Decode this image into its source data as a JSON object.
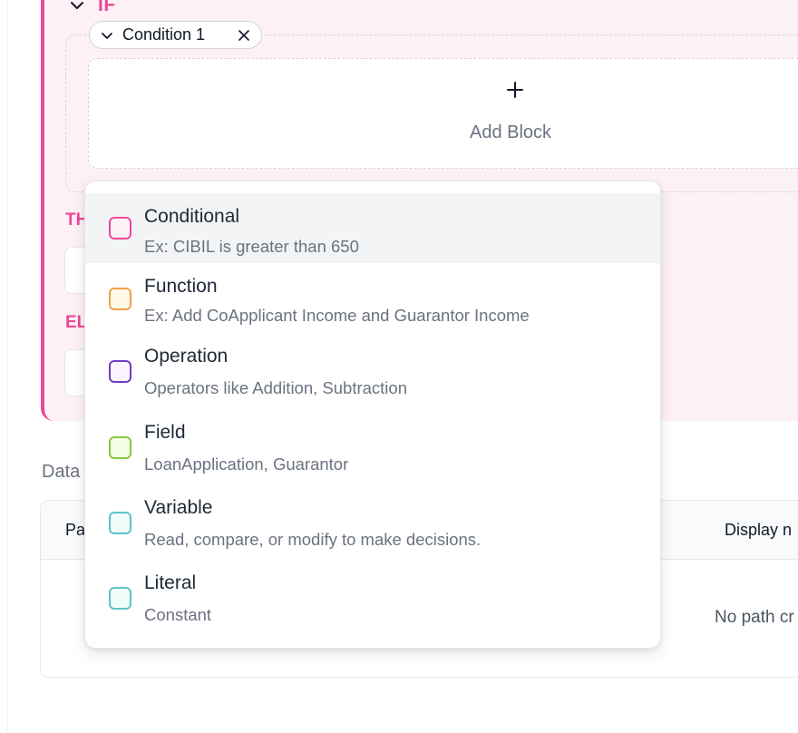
{
  "rule": {
    "if_label": "IF",
    "condition_chip": "Condition 1",
    "add_block_label": "Add Block",
    "then_label": "TH",
    "else_label": "EL"
  },
  "data_section": {
    "label": "Data",
    "col_path": "Pa",
    "col_display": "Display n",
    "empty_text": "No path cr"
  },
  "block_menu": {
    "items": [
      {
        "title": "Conditional",
        "desc": "Ex: CIBIL is greater than 650",
        "color": "#ec4899",
        "fill": "#fdf2f8"
      },
      {
        "title": "Function",
        "desc": "Ex: Add CoApplicant Income and Guarantor Income",
        "color": "#f0a04b",
        "fill": "#fff9e6"
      },
      {
        "title": "Operation",
        "desc": "Operators like Addition, Subtraction",
        "color": "#6d3fc0",
        "fill": "#faf5ff"
      },
      {
        "title": "Field",
        "desc": "LoanApplication, Guarantor",
        "color": "#84cc3f",
        "fill": "#f7fee7"
      },
      {
        "title": "Variable",
        "desc": "Read, compare, or modify to make decisions.",
        "color": "#5fc4c6",
        "fill": "#f0fdfa"
      },
      {
        "title": "Literal",
        "desc": "Constant",
        "color": "#5fc4c6",
        "fill": "#f0fdfa"
      }
    ]
  },
  "colors": {
    "accent": "#ec4899",
    "card_bg": "#fdf1f6"
  },
  "icons": {
    "collapse": "chevron-down-icon",
    "remove": "close-icon",
    "add": "plus-icon"
  }
}
